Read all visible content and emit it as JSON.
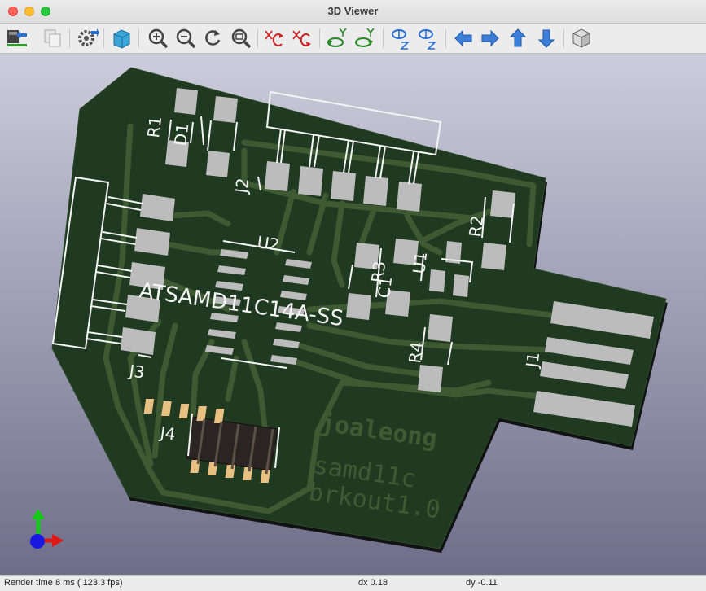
{
  "window": {
    "title": "3D Viewer"
  },
  "toolbar": {
    "buttons": [
      {
        "icon": "reload-board-icon"
      },
      {
        "icon": "copy-image-icon"
      },
      {
        "icon": "settings-icon"
      },
      {
        "icon": "raytracing-icon"
      },
      {
        "icon": "zoom-in-icon"
      },
      {
        "icon": "zoom-out-icon"
      },
      {
        "icon": "refresh-icon"
      },
      {
        "icon": "zoom-fit-icon"
      },
      {
        "icon": "rotate-x-cw-icon"
      },
      {
        "icon": "rotate-x-ccw-icon"
      },
      {
        "icon": "rotate-y-cw-icon"
      },
      {
        "icon": "rotate-y-ccw-icon"
      },
      {
        "icon": "rotate-z-cw-icon"
      },
      {
        "icon": "rotate-z-ccw-icon"
      },
      {
        "icon": "move-left-icon"
      },
      {
        "icon": "move-right-icon"
      },
      {
        "icon": "move-up-icon"
      },
      {
        "icon": "move-down-icon"
      },
      {
        "icon": "ortho-view-icon"
      }
    ]
  },
  "board": {
    "colors": {
      "mask": "#1f3a20",
      "trace": "#3d5a32",
      "pad": "#bcbcbc",
      "silk": "#f4f4f4",
      "edge": "#2c2c2c"
    },
    "references": {
      "r1": "R1",
      "d1": "D1",
      "j2": "J2",
      "u2": "U2",
      "r2": "R2",
      "u1": "U1",
      "r3": "R3",
      "c1": "C1",
      "r4": "R4",
      "j1": "J1",
      "j3": "J3",
      "j4": "J4"
    },
    "chip_label": "ATSAMD11C14A-SS",
    "brand_lines": [
      "joaleong",
      "samd11c",
      "brkout1.0"
    ]
  },
  "axes": {
    "x_color": "#e01818",
    "y_color": "#18c818",
    "z_color": "#1818e0"
  },
  "status": {
    "render_time": "Render time 8 ms ( 123.3 fps)",
    "dx": "dx 0.18",
    "dy": "dy -0.11"
  }
}
